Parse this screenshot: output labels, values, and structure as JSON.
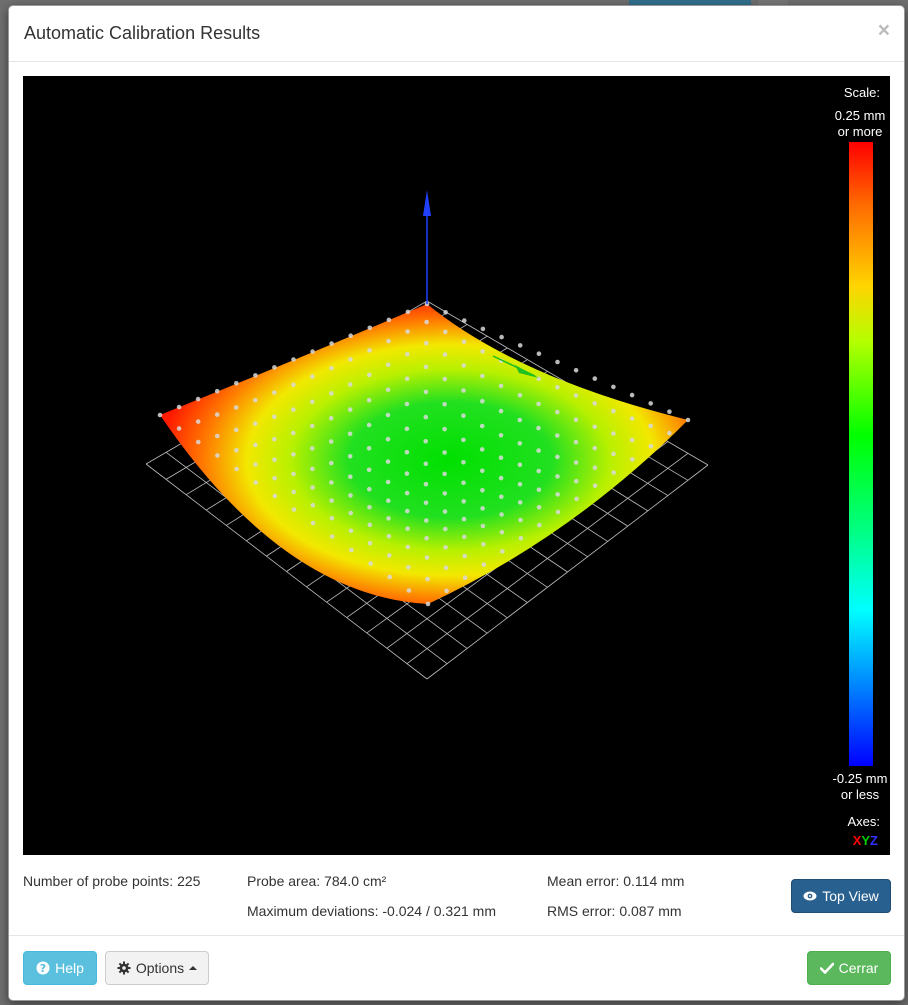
{
  "modal": {
    "title": "Automatic Calibration Results",
    "close_glyph": "×"
  },
  "scale": {
    "title": "Scale:",
    "max_line1": "0.25 mm",
    "max_line2": "or more",
    "min_line1": "-0.25 mm",
    "min_line2": "or less"
  },
  "axes": {
    "title": "Axes:",
    "x": "X",
    "y": "Y",
    "z": "Z",
    "x_color": "#ff0000",
    "y_color": "#00cc00",
    "z_color": "#3030ff"
  },
  "stats": {
    "probe_points": "Number of probe points: 225",
    "probe_area": "Probe area: 784.0 cm²",
    "max_deviations": "Maximum deviations: -0.024 / 0.321 mm",
    "mean_error": "Mean error: 0.114 mm",
    "rms_error": "RMS error: 0.087 mm"
  },
  "buttons": {
    "top_view": "Top View",
    "help": "Help",
    "options": "Options",
    "close": "Cerrar"
  },
  "colors": {
    "primary": "#286090",
    "info": "#5bc0de",
    "success": "#5cb85c",
    "scale_high": "#ff0000",
    "scale_mid": "#00ff00",
    "scale_low": "#0000ff"
  },
  "icons": {
    "top_view": "eye-icon",
    "help": "question-circle-icon",
    "options": "gear-icon",
    "close": "check-icon",
    "options_caret": "caret-up-icon"
  }
}
